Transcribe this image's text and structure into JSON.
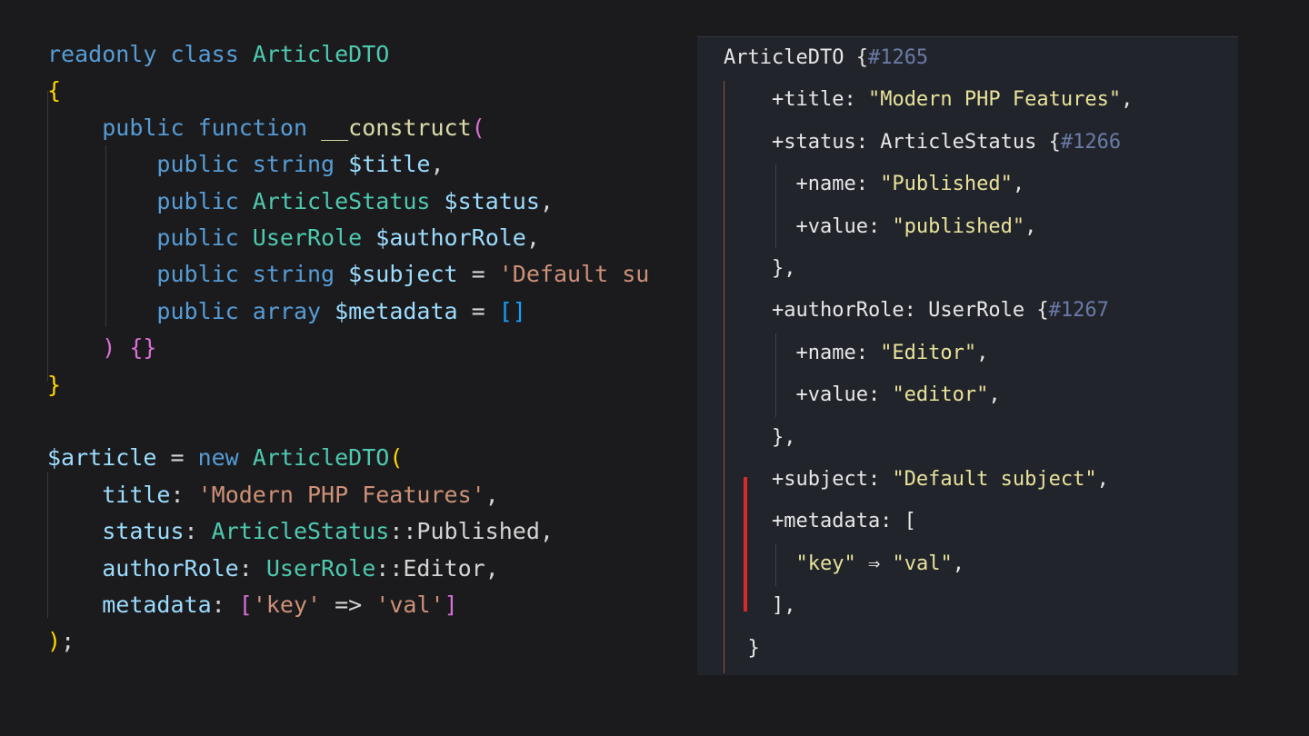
{
  "source_code": {
    "lines": [
      [
        {
          "t": "readonly",
          "s": "kw"
        },
        {
          "t": " ",
          "s": "plain"
        },
        {
          "t": "class",
          "s": "kw"
        },
        {
          "t": " ",
          "s": "plain"
        },
        {
          "t": "ArticleDTO",
          "s": "type"
        }
      ],
      [
        {
          "t": "{",
          "s": "gold"
        }
      ],
      [
        {
          "t": "    ",
          "s": "plain"
        },
        {
          "t": "public",
          "s": "kw"
        },
        {
          "t": " ",
          "s": "plain"
        },
        {
          "t": "function",
          "s": "kw"
        },
        {
          "t": " ",
          "s": "plain"
        },
        {
          "t": "__construct",
          "s": "fn"
        },
        {
          "t": "(",
          "s": "pink"
        }
      ],
      [
        {
          "t": "        ",
          "s": "plain"
        },
        {
          "t": "public",
          "s": "kw"
        },
        {
          "t": " ",
          "s": "plain"
        },
        {
          "t": "string",
          "s": "kw"
        },
        {
          "t": " ",
          "s": "plain"
        },
        {
          "t": "$title",
          "s": "var"
        },
        {
          "t": ",",
          "s": "plain"
        }
      ],
      [
        {
          "t": "        ",
          "s": "plain"
        },
        {
          "t": "public",
          "s": "kw"
        },
        {
          "t": " ",
          "s": "plain"
        },
        {
          "t": "ArticleStatus",
          "s": "type"
        },
        {
          "t": " ",
          "s": "plain"
        },
        {
          "t": "$status",
          "s": "var"
        },
        {
          "t": ",",
          "s": "plain"
        }
      ],
      [
        {
          "t": "        ",
          "s": "plain"
        },
        {
          "t": "public",
          "s": "kw"
        },
        {
          "t": " ",
          "s": "plain"
        },
        {
          "t": "UserRole",
          "s": "type"
        },
        {
          "t": " ",
          "s": "plain"
        },
        {
          "t": "$authorRole",
          "s": "var"
        },
        {
          "t": ",",
          "s": "plain"
        }
      ],
      [
        {
          "t": "        ",
          "s": "plain"
        },
        {
          "t": "public",
          "s": "kw"
        },
        {
          "t": " ",
          "s": "plain"
        },
        {
          "t": "string",
          "s": "kw"
        },
        {
          "t": " ",
          "s": "plain"
        },
        {
          "t": "$subject",
          "s": "var"
        },
        {
          "t": " = ",
          "s": "plain"
        },
        {
          "t": "'Default su",
          "s": "str"
        }
      ],
      [
        {
          "t": "        ",
          "s": "plain"
        },
        {
          "t": "public",
          "s": "kw"
        },
        {
          "t": " ",
          "s": "plain"
        },
        {
          "t": "array",
          "s": "kw"
        },
        {
          "t": " ",
          "s": "plain"
        },
        {
          "t": "$metadata",
          "s": "var"
        },
        {
          "t": " = ",
          "s": "plain"
        },
        {
          "t": "[]",
          "s": "blue"
        }
      ],
      [
        {
          "t": "    ",
          "s": "plain"
        },
        {
          "t": ")",
          "s": "pink"
        },
        {
          "t": " ",
          "s": "plain"
        },
        {
          "t": "{}",
          "s": "pink"
        }
      ],
      [
        {
          "t": "}",
          "s": "gold"
        }
      ],
      [],
      [
        {
          "t": "$article",
          "s": "var"
        },
        {
          "t": " = ",
          "s": "plain"
        },
        {
          "t": "new",
          "s": "kw"
        },
        {
          "t": " ",
          "s": "plain"
        },
        {
          "t": "ArticleDTO",
          "s": "type"
        },
        {
          "t": "(",
          "s": "gold"
        }
      ],
      [
        {
          "t": "    ",
          "s": "plain"
        },
        {
          "t": "title",
          "s": "prop"
        },
        {
          "t": ": ",
          "s": "plain"
        },
        {
          "t": "'Modern PHP Features'",
          "s": "str"
        },
        {
          "t": ",",
          "s": "plain"
        }
      ],
      [
        {
          "t": "    ",
          "s": "plain"
        },
        {
          "t": "status",
          "s": "prop"
        },
        {
          "t": ": ",
          "s": "plain"
        },
        {
          "t": "ArticleStatus",
          "s": "type"
        },
        {
          "t": "::Published,",
          "s": "plain"
        }
      ],
      [
        {
          "t": "    ",
          "s": "plain"
        },
        {
          "t": "authorRole",
          "s": "prop"
        },
        {
          "t": ": ",
          "s": "plain"
        },
        {
          "t": "UserRole",
          "s": "type"
        },
        {
          "t": "::Editor,",
          "s": "plain"
        }
      ],
      [
        {
          "t": "    ",
          "s": "plain"
        },
        {
          "t": "metadata",
          "s": "prop"
        },
        {
          "t": ": ",
          "s": "plain"
        },
        {
          "t": "[",
          "s": "pink"
        },
        {
          "t": "'key'",
          "s": "str"
        },
        {
          "t": " => ",
          "s": "plain"
        },
        {
          "t": "'val'",
          "s": "str"
        },
        {
          "t": "]",
          "s": "pink"
        }
      ],
      [
        {
          "t": ")",
          "s": "gold"
        },
        {
          "t": ";",
          "s": "plain"
        }
      ]
    ]
  },
  "dump_output": {
    "lines": [
      [
        {
          "t": "ArticleDTO ",
          "s": "class"
        },
        {
          "t": "{",
          "s": "punc"
        },
        {
          "t": "#1265",
          "s": "id"
        }
      ],
      [
        {
          "t": "    +title: ",
          "s": "key"
        },
        {
          "t": "\"Modern PHP Features\"",
          "s": "str"
        },
        {
          "t": ",",
          "s": "punc"
        }
      ],
      [
        {
          "t": "    +status: ",
          "s": "key"
        },
        {
          "t": "ArticleStatus ",
          "s": "class"
        },
        {
          "t": "{",
          "s": "punc"
        },
        {
          "t": "#1266",
          "s": "id"
        }
      ],
      [
        {
          "t": "      +name: ",
          "s": "key"
        },
        {
          "t": "\"Published\"",
          "s": "str"
        },
        {
          "t": ",",
          "s": "punc"
        }
      ],
      [
        {
          "t": "      +value: ",
          "s": "key"
        },
        {
          "t": "\"published\"",
          "s": "str"
        },
        {
          "t": ",",
          "s": "punc"
        }
      ],
      [
        {
          "t": "    },",
          "s": "punc"
        }
      ],
      [
        {
          "t": "    +authorRole: ",
          "s": "key"
        },
        {
          "t": "UserRole ",
          "s": "class"
        },
        {
          "t": "{",
          "s": "punc"
        },
        {
          "t": "#1267",
          "s": "id"
        }
      ],
      [
        {
          "t": "      +name: ",
          "s": "key"
        },
        {
          "t": "\"Editor\"",
          "s": "str"
        },
        {
          "t": ",",
          "s": "punc"
        }
      ],
      [
        {
          "t": "      +value: ",
          "s": "key"
        },
        {
          "t": "\"editor\"",
          "s": "str"
        },
        {
          "t": ",",
          "s": "punc"
        }
      ],
      [
        {
          "t": "    },",
          "s": "punc"
        }
      ],
      [
        {
          "t": "    +subject: ",
          "s": "key"
        },
        {
          "t": "\"Default subject\"",
          "s": "str"
        },
        {
          "t": ",",
          "s": "punc"
        }
      ],
      [
        {
          "t": "    +metadata: [",
          "s": "key"
        }
      ],
      [
        {
          "t": "      ",
          "s": "key"
        },
        {
          "t": "\"key\"",
          "s": "str"
        },
        {
          "t": " ⇒ ",
          "s": "punc"
        },
        {
          "t": "\"val\"",
          "s": "str"
        },
        {
          "t": ",",
          "s": "punc"
        }
      ],
      [
        {
          "t": "    ],",
          "s": "punc"
        }
      ],
      [
        {
          "t": "  }",
          "s": "punc"
        }
      ]
    ]
  }
}
